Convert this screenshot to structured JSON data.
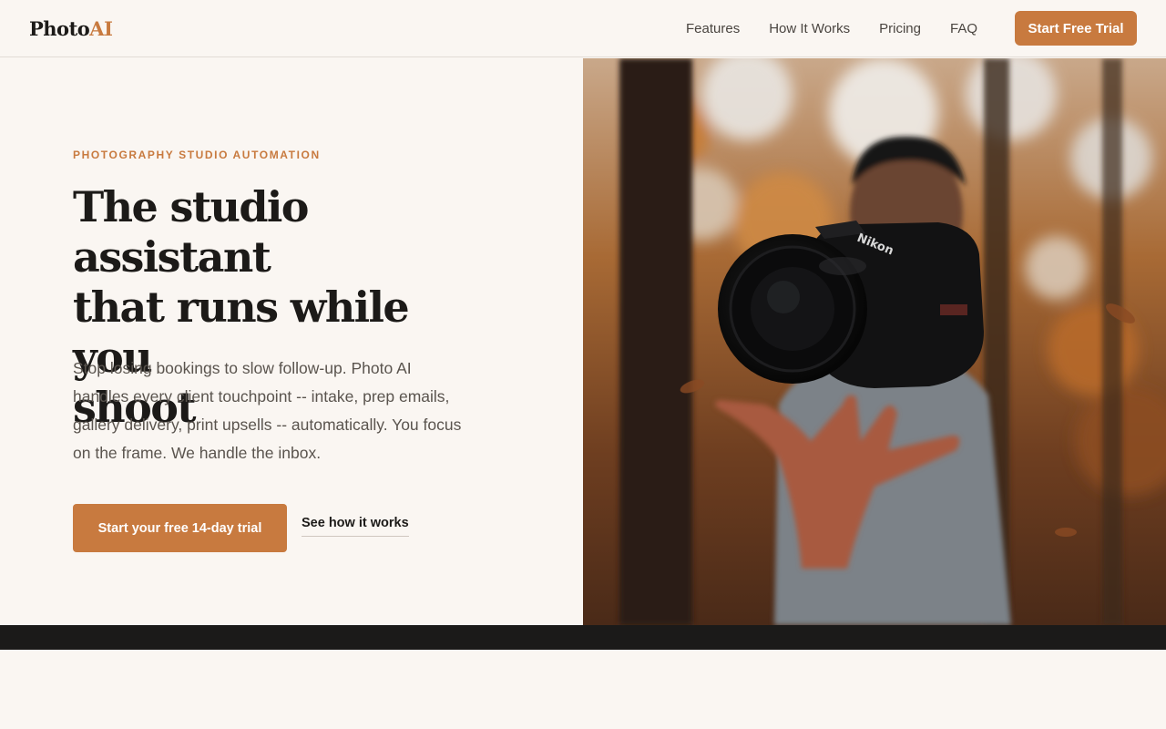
{
  "nav": {
    "logo_main": "Photo",
    "logo_accent": "AI",
    "links": [
      "Features",
      "How It Works",
      "Pricing",
      "FAQ"
    ],
    "cta": "Start Free Trial"
  },
  "hero": {
    "eyebrow": "PHOTOGRAPHY STUDIO AUTOMATION",
    "headline_lines": [
      "The studio assistant",
      "that runs while you",
      "shoot"
    ],
    "lead": "Stop losing bookings to slow follow-up. Photo AI handles every client touchpoint -- intake, prep emails, gallery delivery, print upsells -- automatically. You focus on the frame. We handle the inbox.",
    "primary_cta": "Start your free 14-day trial",
    "secondary_cta": "See how it works",
    "photo": {
      "camera_brand": "Nikon"
    }
  },
  "colors": {
    "accent": "#c87a3f",
    "background": "#faf6f2",
    "text": "#1c1a18",
    "dark_band": "#1b1a19"
  }
}
